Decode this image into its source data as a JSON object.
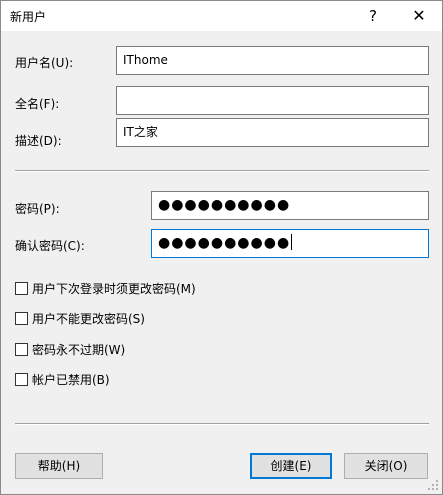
{
  "window": {
    "title": "新用户",
    "help_glyph": "?",
    "close_glyph": "✕"
  },
  "fields": {
    "username": {
      "label": "用户名(U):",
      "value": "IThome"
    },
    "fullname": {
      "label": "全名(F):",
      "value": ""
    },
    "description": {
      "label": "描述(D):",
      "value": "IT之家"
    },
    "password": {
      "label": "密码(P):",
      "value": "●●●●●●●●●●"
    },
    "confirm": {
      "label": "确认密码(C):",
      "value": "●●●●●●●●●●"
    }
  },
  "options": [
    {
      "label": "用户下次登录时须更改密码(M)",
      "checked": false
    },
    {
      "label": "用户不能更改密码(S)",
      "checked": false
    },
    {
      "label": "密码永不过期(W)",
      "checked": false
    },
    {
      "label": "帐户已禁用(B)",
      "checked": false
    }
  ],
  "buttons": {
    "help": "帮助(H)",
    "create": "创建(E)",
    "close": "关闭(O)"
  },
  "colors": {
    "accent": "#0078d7",
    "face": "#f0f0f0"
  }
}
